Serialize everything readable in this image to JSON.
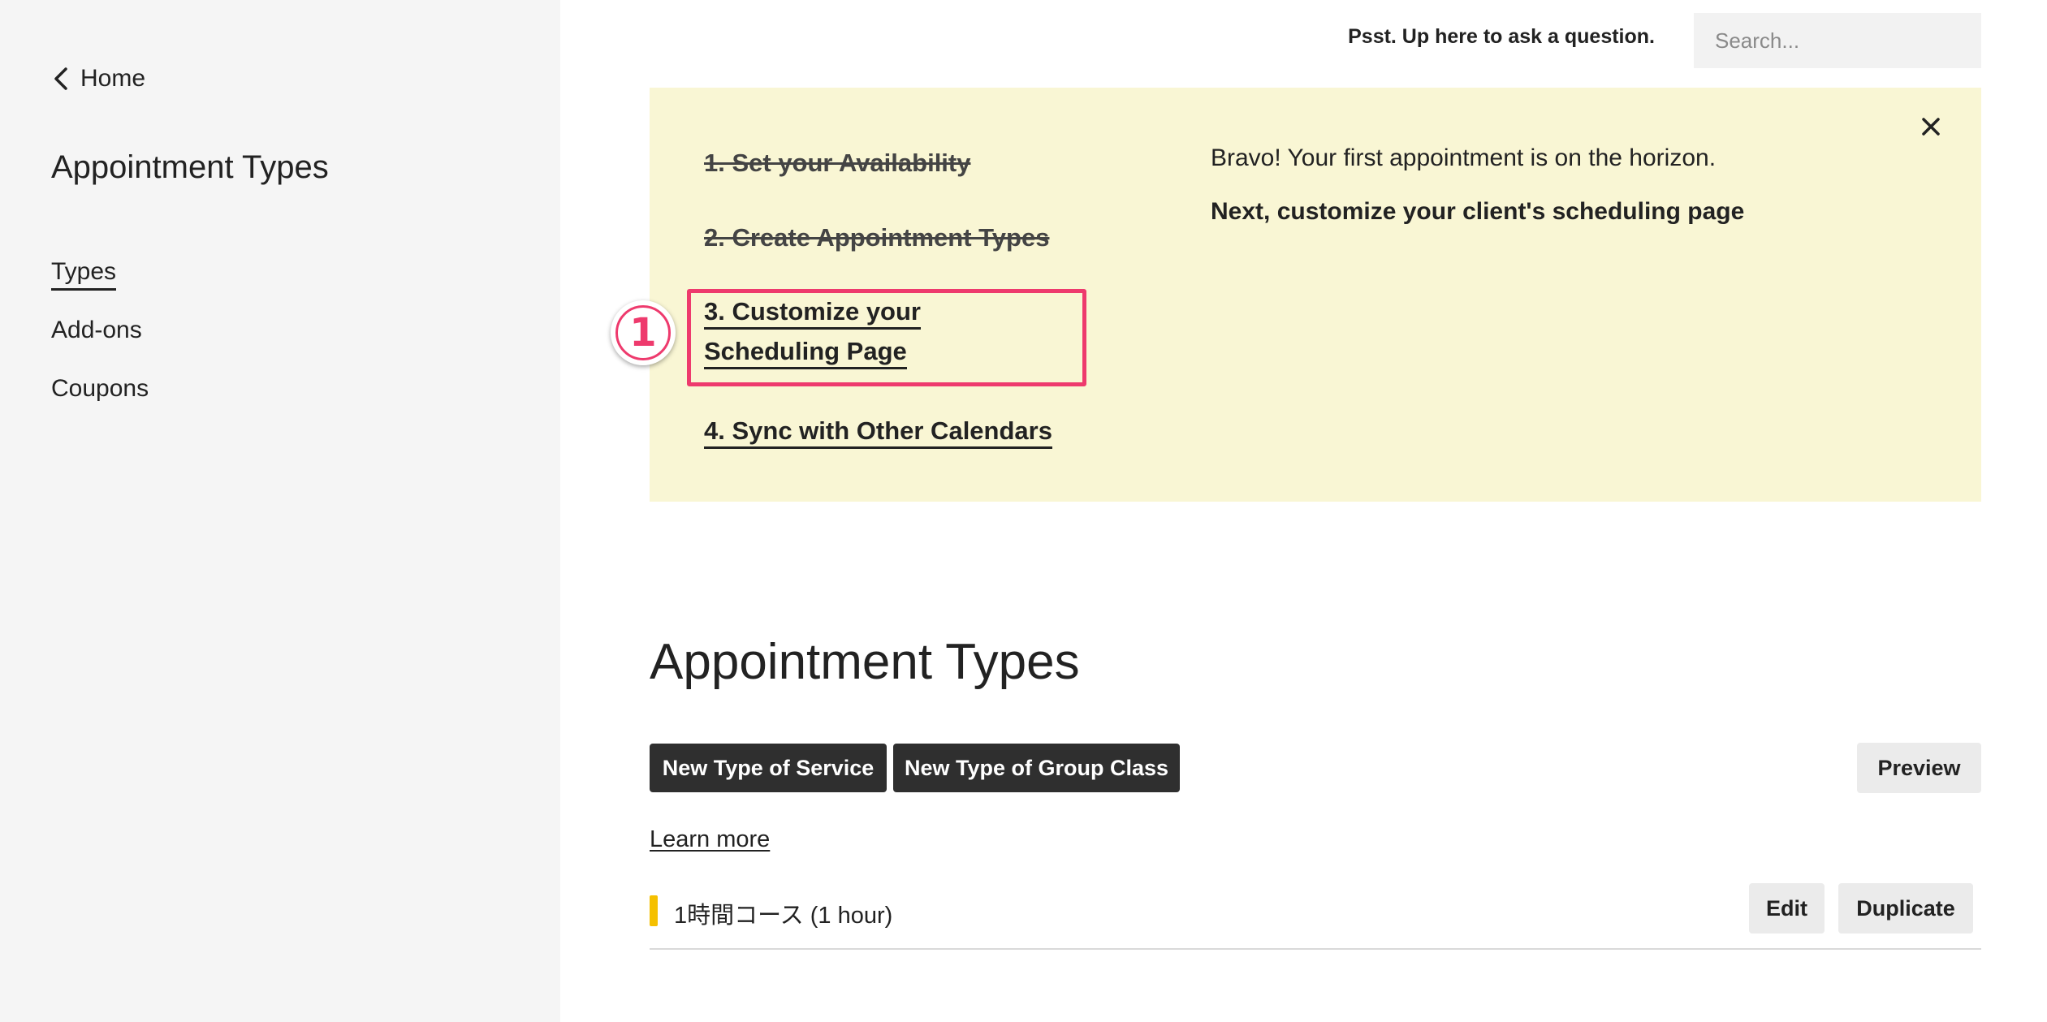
{
  "sidebar": {
    "back_label": "Home",
    "title": "Appointment Types",
    "nav": [
      {
        "label": "Types",
        "active": true
      },
      {
        "label": "Add-ons",
        "active": false
      },
      {
        "label": "Coupons",
        "active": false
      }
    ]
  },
  "topbar": {
    "prompt": "Psst. Up here to ask a question.",
    "search_placeholder": "Search..."
  },
  "banner": {
    "steps": [
      {
        "label": "1. Set your Availability",
        "state": "done"
      },
      {
        "label": "2. Create Appointment Types",
        "state": "done"
      },
      {
        "label": "3. Customize your Scheduling Page",
        "state": "current"
      },
      {
        "label": "4. Sync with Other Calendars",
        "state": "todo"
      }
    ],
    "message": "Bravo! Your first appointment is on the horizon.",
    "next": "Next, customize your client's scheduling page",
    "marker": "1",
    "highlight_color": "#ee3a6d",
    "background_color": "#f9f6d4"
  },
  "main": {
    "title": "Appointment Types",
    "new_service_label": "New Type of Service",
    "new_group_label": "New Type of Group Class",
    "preview_label": "Preview",
    "learn_more_label": "Learn more",
    "types": [
      {
        "name": "1時間コース (1 hour)",
        "color": "#f5c000",
        "edit_label": "Edit",
        "duplicate_label": "Duplicate"
      }
    ]
  }
}
